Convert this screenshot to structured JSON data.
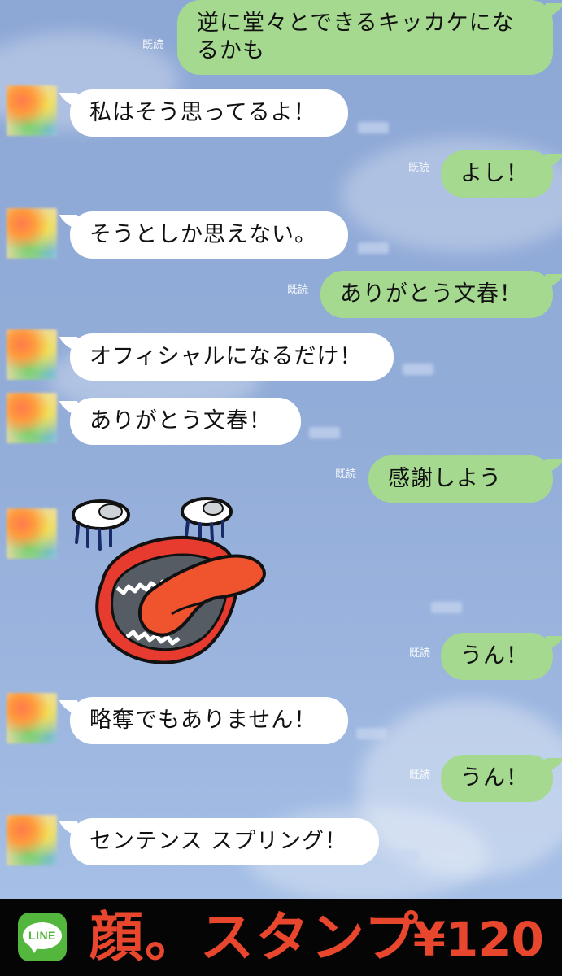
{
  "chat": {
    "messages": [
      {
        "side": "out",
        "read": "既読",
        "text": "逆に堂々とできるキッカケにな",
        "text2": "るかも"
      },
      {
        "side": "in",
        "text": "私はそう思ってるよ！"
      },
      {
        "side": "out",
        "read": "既読",
        "text": "よし！"
      },
      {
        "side": "in",
        "text": "そうとしか思えない。"
      },
      {
        "side": "out",
        "read": "既読",
        "text": "ありがとう文春！"
      },
      {
        "side": "in",
        "text": "オフィシャルになるだけ！"
      },
      {
        "side": "in",
        "text": "ありがとう文春！"
      },
      {
        "side": "out",
        "read": "既読",
        "text": "感謝しよう"
      },
      {
        "side": "in",
        "sticker": "face-sticker"
      },
      {
        "side": "out",
        "read": "既読",
        "text": "うん！"
      },
      {
        "side": "in",
        "text": "略奪でもありません！"
      },
      {
        "side": "out",
        "read": "既読",
        "text": "うん！"
      },
      {
        "side": "in",
        "text": "センテンス スプリング！"
      }
    ]
  },
  "footer": {
    "logo_text": "LINE",
    "title": "顔。スタンプ",
    "price": "¥120"
  },
  "colors": {
    "incoming_bubble": "#ffffff",
    "outgoing_bubble": "#a5d98f",
    "accent": "#e9462e",
    "line_green": "#53b73d"
  }
}
